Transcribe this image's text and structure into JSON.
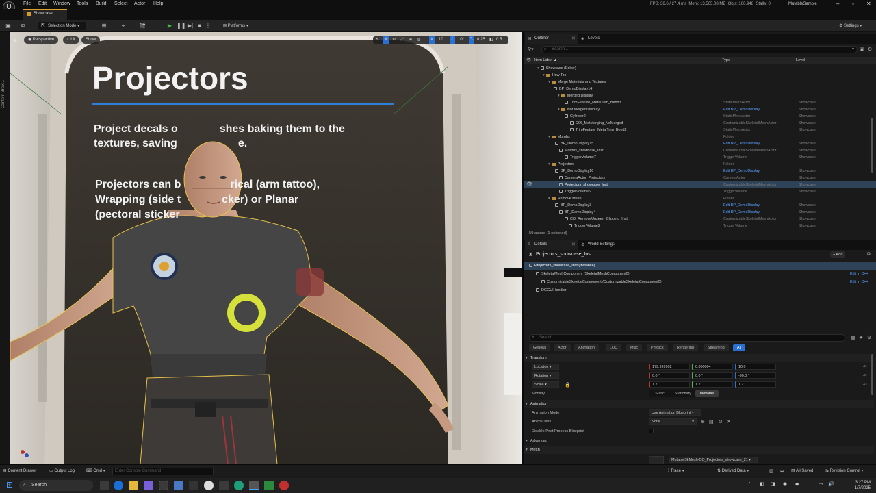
{
  "menu": {
    "items": [
      "File",
      "Edit",
      "Window",
      "Tools",
      "Build",
      "Select",
      "Actor",
      "Help"
    ]
  },
  "stats": {
    "fps": "FPS: 36.6 / 27.4 ms",
    "mem": "Mem: 13,565.08 MB",
    "objs": "Objs: 160,948",
    "stalls": "Stalls: 0"
  },
  "project_name": "MutableSample",
  "tab": {
    "label": "Showcase"
  },
  "toolbar": {
    "mode": "Selection Mode",
    "platforms": "Platforms",
    "settings": "Settings"
  },
  "viewport": {
    "buttons": [
      "Perspective",
      "Lit",
      "Show"
    ],
    "right_values": [
      "10",
      "10°",
      "0.25",
      "0.5"
    ],
    "sign_title": "Projectors",
    "sign_text1": "Project decals on meshes baking them to the textures, saving memory.",
    "sign_text2": "Projectors can be cylindrical (arm tattoo), Wrapping (side torso sticker) or Planar (pectoral sticker).",
    "sign_visible1a": "Project decals o",
    "sign_visible1b": "shes baking them to the",
    "sign_visible1c": "textures, saving",
    "sign_visible1d": "e.",
    "sign_visible2a": "Projectors can b",
    "sign_visible2b": "rical (arm tattoo),",
    "sign_visible2c": "Wrapping (side t",
    "sign_visible2d": "cker) or Planar",
    "sign_visible2e": "(pectoral sticker"
  },
  "content_browser_strip": "Content Brow...",
  "outliner": {
    "tab": "Outliner",
    "tab2": "Levels",
    "search_placeholder": "Search...",
    "columns": {
      "label": "Item Label ▲",
      "type": "Type",
      "level": "Level"
    },
    "rows": [
      {
        "label": "Showcase (Editor)",
        "type": "",
        "level": "",
        "indent": 20,
        "kind": "world"
      },
      {
        "label": "How Tos",
        "type": "",
        "level": "",
        "indent": 28,
        "kind": "folder"
      },
      {
        "label": "Merge Materials and Textures",
        "type": "",
        "level": "",
        "indent": 36,
        "kind": "folder"
      },
      {
        "label": "BP_DemoDisplay14",
        "type": "",
        "level": "",
        "indent": 42,
        "kind": "actor"
      },
      {
        "label": "Merged Display",
        "type": "",
        "level": "",
        "indent": 50,
        "kind": "folder"
      },
      {
        "label": "TrimFeature_MetalTrim_Bend3",
        "type": "StaticMeshActor",
        "level": "Showcase",
        "indent": 58,
        "kind": "actor"
      },
      {
        "label": "Not Merged Display",
        "type": "Edit BP_DemoDisplay",
        "level": "Showcase",
        "indent": 50,
        "kind": "folder",
        "link": true
      },
      {
        "label": "Cylinder2",
        "type": "StaticMeshActor",
        "level": "Showcase",
        "indent": 58,
        "kind": "actor"
      },
      {
        "label": "COI_MatMerging_NoMerged",
        "type": "CustomizableSkeletalMeshActor",
        "level": "Showcase",
        "indent": 66,
        "kind": "actor"
      },
      {
        "label": "TrimFeature_MetalTrim_Bend2",
        "type": "StaticMeshActor",
        "level": "Showcase",
        "indent": 66,
        "kind": "actor"
      },
      {
        "label": "Morphs",
        "type": "Folder",
        "level": "",
        "indent": 36,
        "kind": "folder"
      },
      {
        "label": "BP_DemoDisplay15",
        "type": "Edit BP_DemoDisplay",
        "level": "Showcase",
        "indent": 44,
        "kind": "actor",
        "link": true
      },
      {
        "label": "Morphs_showcase_Inst",
        "type": "CustomizableSkeletalMeshActor",
        "level": "Showcase",
        "indent": 50,
        "kind": "actor"
      },
      {
        "label": "TriggerVolume7",
        "type": "TriggerVolume",
        "level": "Showcase",
        "indent": 58,
        "kind": "actor"
      },
      {
        "label": "Projectors",
        "type": "Folder",
        "level": "",
        "indent": 36,
        "kind": "folder"
      },
      {
        "label": "BP_DemoDisplay16",
        "type": "Edit BP_DemoDisplay",
        "level": "Showcase",
        "indent": 44,
        "kind": "actor",
        "link": true
      },
      {
        "label": "CameraActor_Projectors",
        "type": "CameraActor",
        "level": "Showcase",
        "indent": 50,
        "kind": "actor"
      },
      {
        "label": "Projectors_showcase_Inst",
        "type": "CustomizableSkeletalMeshActor",
        "level": "Showcase",
        "indent": 50,
        "kind": "actor",
        "selected": true
      },
      {
        "label": "TriggerVolume6",
        "type": "TriggerVolume",
        "level": "Showcase",
        "indent": 50,
        "kind": "actor"
      },
      {
        "label": "Remove Mesh",
        "type": "Folder",
        "level": "",
        "indent": 36,
        "kind": "folder"
      },
      {
        "label": "BP_DemoDisplay3",
        "type": "Edit BP_DemoDisplay",
        "level": "Showcase",
        "indent": 44,
        "kind": "actor",
        "link": true
      },
      {
        "label": "BP_DemoDisplay4",
        "type": "Edit BP_DemoDisplay",
        "level": "Showcase",
        "indent": 50,
        "kind": "actor",
        "link": true
      },
      {
        "label": "CO_RemoveUnseen_Clipping_Inst",
        "type": "CustomizableSkeletalMeshActor",
        "level": "Showcase",
        "indent": 58,
        "kind": "actor"
      },
      {
        "label": "TriggerVolume2",
        "type": "TriggerVolume",
        "level": "Showcase",
        "indent": 64,
        "kind": "actor"
      }
    ],
    "footer": "59 actors (1 selected)"
  },
  "details": {
    "tab": "Details",
    "tab2": "World Settings",
    "actor_name": "Projectors_showcase_Inst",
    "add_label": "+ Add",
    "components": [
      {
        "label": "Projectors_showcase_Inst (Instance)",
        "edit": "",
        "indent": 8,
        "selected": true
      },
      {
        "label": "SkeletalMeshComponent (SkeletalMeshComponent0)",
        "edit": "Edit in C++",
        "indent": 18
      },
      {
        "label": "CustomizableSkeletalComponent (CustomizableSkeletalComponent0)",
        "edit": "Edit in C++",
        "indent": 26
      },
      {
        "label": "DGGUIHandler",
        "edit": "",
        "indent": 18
      }
    ],
    "search_placeholder": "Search",
    "categories": [
      "General",
      "Actor",
      "Animation",
      "LOD",
      "Misc",
      "Physics",
      "Rendering",
      "Streaming",
      "All"
    ],
    "active_category": "All",
    "sections": {
      "transform": "Transform",
      "animation": "Animation",
      "advanced": "Advanced",
      "mesh": "Mesh"
    },
    "location": {
      "label": "Location",
      "x": "179.999902",
      "y": "0.000004",
      "z": "10.0"
    },
    "rotation": {
      "label": "Rotation",
      "x": "0.0 °",
      "y": "0.0 °",
      "z": "-90.0 °"
    },
    "scale": {
      "label": "Scale",
      "x": "1.2",
      "y": "1.2",
      "z": "1.2"
    },
    "mobility": {
      "label": "Mobility",
      "options": [
        "Static",
        "Stationary",
        "Movable"
      ],
      "selected": "Movable"
    },
    "anim_mode": {
      "label": "Animation Mode",
      "value": "Use Animation Blueprint"
    },
    "anim_class": {
      "label": "Anim Class",
      "value": "None"
    },
    "disable_pp": {
      "label": "Disable Post Process Blueprint"
    },
    "mesh_value": "MutableSkMesh-CO_Projectors_showcase_21"
  },
  "statusbar": {
    "content_drawer": "Content Drawer",
    "output_log": "Output Log",
    "cmd": "Cmd",
    "console_placeholder": "Enter Console Command",
    "trace": "Trace",
    "derived": "Derived Data",
    "saved": "All Saved",
    "revision": "Revision Control"
  },
  "taskbar": {
    "search": "Search",
    "time": "3:27 PM",
    "date": "1/7/2025"
  },
  "colors": {
    "accent": "#2a70d0",
    "selection": "#2f4358",
    "link": "#5aa0ff",
    "folder": "#b88c3c",
    "play": "#3fbf3f"
  }
}
